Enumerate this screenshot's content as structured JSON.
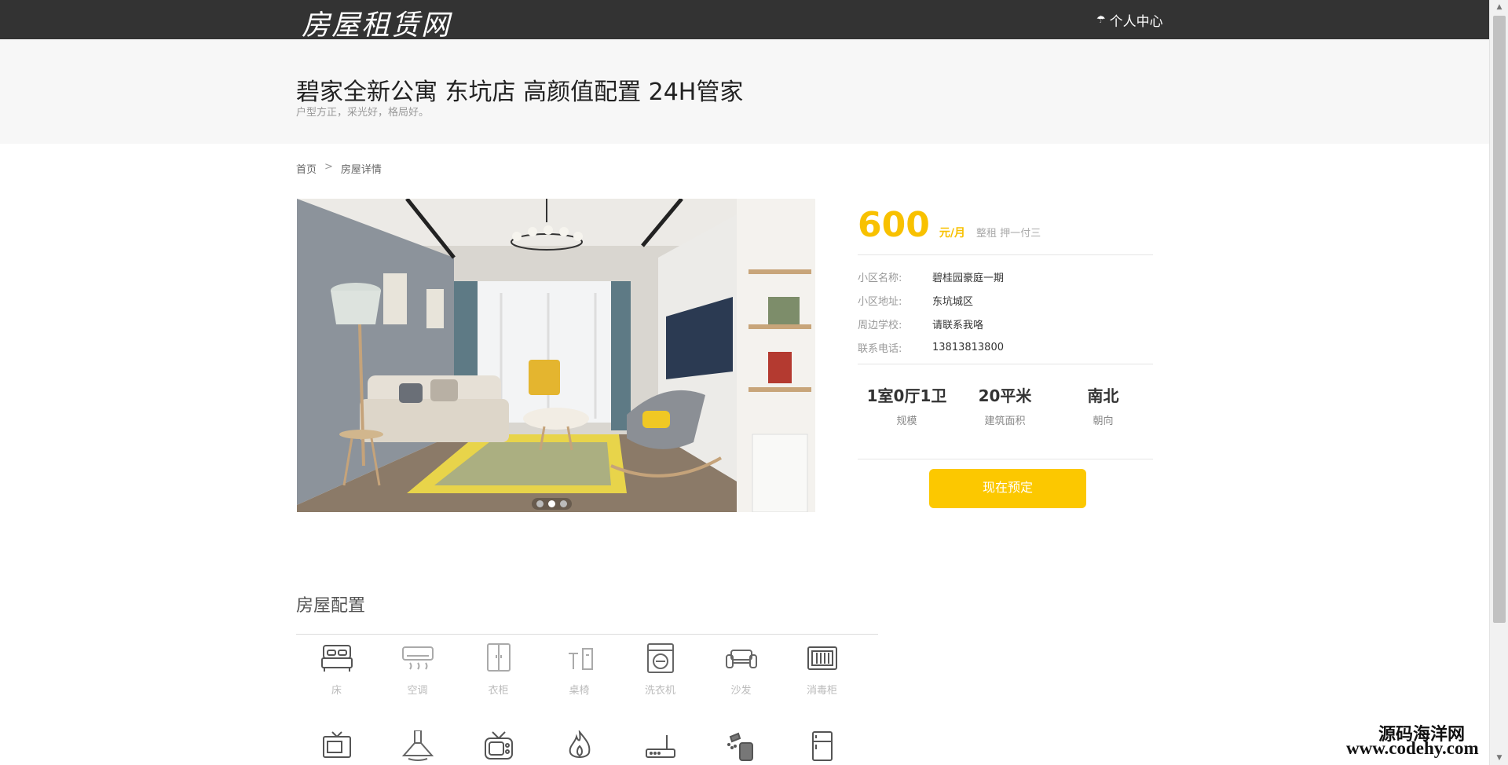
{
  "header": {
    "logo": "房屋租赁网",
    "user_center": "个人中心",
    "user_icon": "umbrella-icon"
  },
  "listing": {
    "title": "碧家全新公寓 东坑店 高颜值配置 24H管家",
    "subtitle": "户型方正，采光好，格局好。"
  },
  "breadcrumb": {
    "home": "首页",
    "separator": ">",
    "current": "房屋详情"
  },
  "gallery": {
    "slide_count": 3,
    "active_slide": 2
  },
  "price": {
    "amount": "600",
    "unit": "元/月",
    "terms": "整租 押一付三"
  },
  "info": [
    {
      "key": "小区名称:",
      "value": "碧桂园豪庭一期"
    },
    {
      "key": "小区地址:",
      "value": "东坑城区"
    },
    {
      "key": "周边学校:",
      "value": "请联系我咯"
    },
    {
      "key": "联系电话:",
      "value": "13813813800"
    }
  ],
  "stats": [
    {
      "value": "1室0厅1卫",
      "label": "规模"
    },
    {
      "value": "20平米",
      "label": "建筑面积"
    },
    {
      "value": "南北",
      "label": "朝向"
    }
  ],
  "book_button": "现在预定",
  "config": {
    "title": "房屋配置",
    "items": [
      {
        "label": "床",
        "icon": "bed-icon"
      },
      {
        "label": "空调",
        "icon": "air-conditioner-icon"
      },
      {
        "label": "衣柜",
        "icon": "wardrobe-icon"
      },
      {
        "label": "桌椅",
        "icon": "desk-chair-icon"
      },
      {
        "label": "洗衣机",
        "icon": "washing-machine-icon"
      },
      {
        "label": "沙发",
        "icon": "sofa-icon"
      },
      {
        "label": "消毒柜",
        "icon": "sterilizer-icon"
      },
      {
        "label": "",
        "icon": "tv-icon"
      },
      {
        "label": "",
        "icon": "range-hood-icon"
      },
      {
        "label": "",
        "icon": "cable-tv-icon"
      },
      {
        "label": "",
        "icon": "gas-fire-icon"
      },
      {
        "label": "",
        "icon": "router-icon"
      },
      {
        "label": "",
        "icon": "water-heater-icon"
      },
      {
        "label": "",
        "icon": "fridge-icon"
      }
    ]
  },
  "watermark": {
    "line1": "源码海洋网",
    "line2": "www.codehy.com"
  },
  "colors": {
    "accent": "#fcc800",
    "topbar": "#333333",
    "title_band": "#f7f7f7"
  }
}
